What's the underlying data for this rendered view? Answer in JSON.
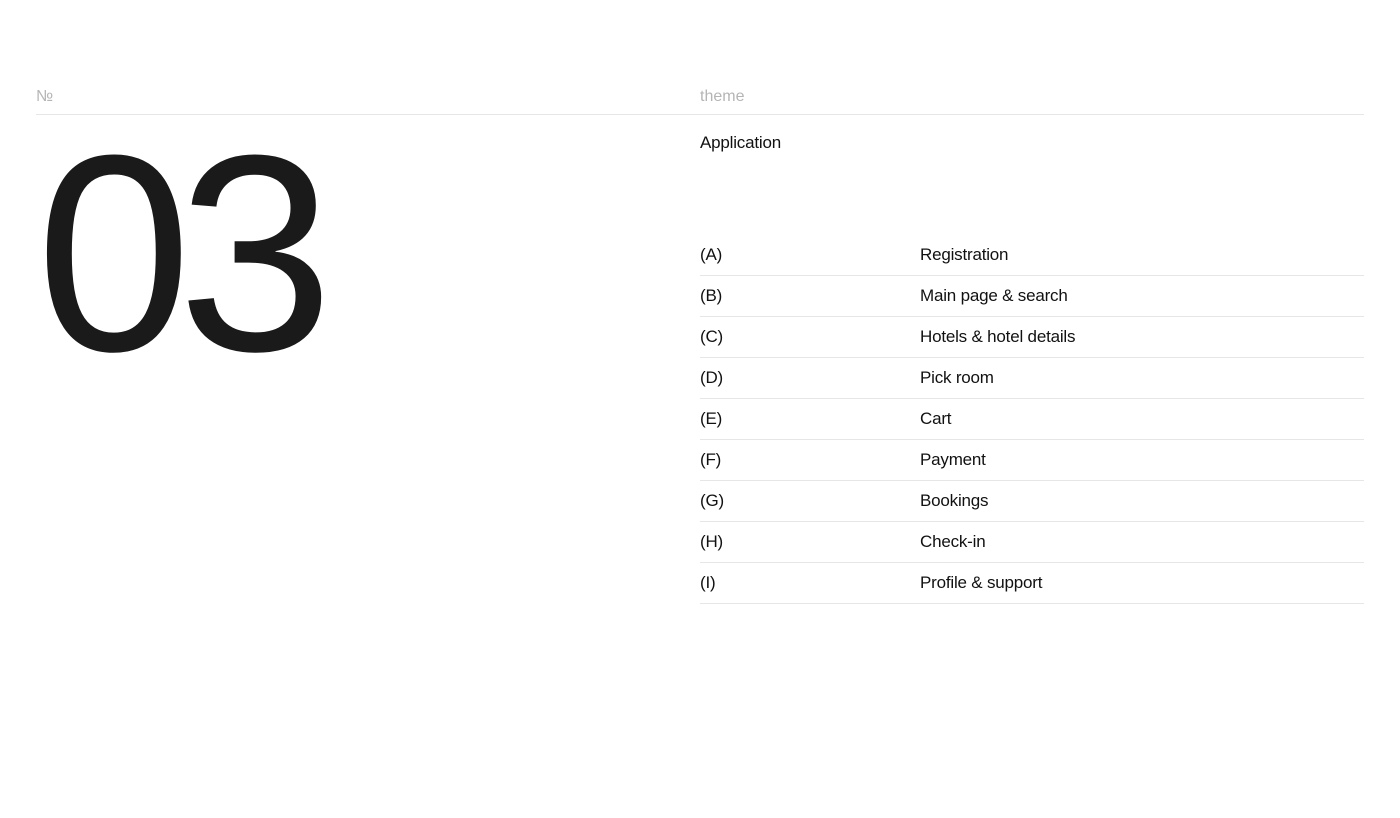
{
  "header": {
    "left_label": "№",
    "right_label": "theme"
  },
  "number": "03",
  "theme_title": "Application",
  "items": [
    {
      "key": "(A)",
      "value": "Registration"
    },
    {
      "key": "(B)",
      "value": "Main page & search"
    },
    {
      "key": "(C)",
      "value": "Hotels & hotel details"
    },
    {
      "key": "(D)",
      "value": "Pick room"
    },
    {
      "key": "(E)",
      "value": "Cart"
    },
    {
      "key": "(F)",
      "value": "Payment"
    },
    {
      "key": "(G)",
      "value": "Bookings"
    },
    {
      "key": "(H)",
      "value": "Check-in"
    },
    {
      "key": "(I)",
      "value": "Profile & support"
    }
  ]
}
